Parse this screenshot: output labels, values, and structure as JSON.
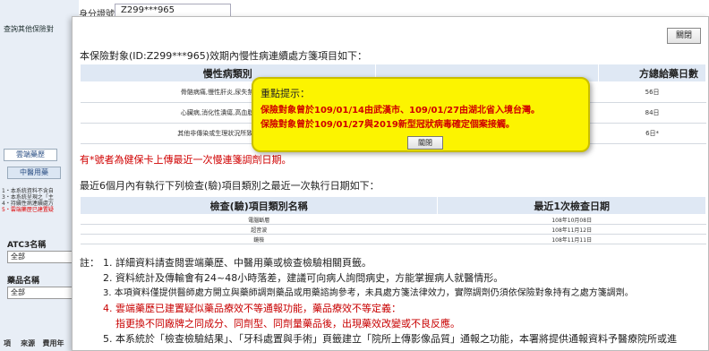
{
  "background": {
    "id_label": "身分證號：",
    "id_value": "Z299***965",
    "query_other": "查詢其他保險對",
    "tab_cloud": "雲端藥歷",
    "tab_chinese": "中醫用藥",
    "notes": [
      "1・本系統資料不含自",
      "3・本系統呈現之「主",
      "4・持續性病連續處方",
      "5・雲端藥歷已建置疑"
    ],
    "atc_label": "ATC3名稱",
    "atc_value": "全部",
    "drug_label": "藥品名稱",
    "drug_value": "全部",
    "footer_cols": [
      "項",
      "來源",
      "費用年"
    ]
  },
  "dialog": {
    "close_label": "關閉",
    "chronic_title": "本保險對象(ID:Z299***965)效期內慢性病連續處方箋項目如下：",
    "chronic_headers": [
      "慢性病類別",
      "方總給藥日數"
    ],
    "chronic_rows": [
      {
        "category": "骨骼病痛,慢性肝炎,尿失禁,身心疾",
        "days": "56日"
      },
      {
        "category": "心臟病,消化性潰瘍,高血脂症,高血",
        "days": "84日"
      },
      {
        "category": "其他非傳染或生理狀況所致之睡眠疾",
        "days": "6日*"
      }
    ],
    "star_note": "有*號者為健保卡上傳最近一次慢連箋調劑日期。",
    "exam_title": "最近6個月內有執行下列檢查(驗)項目類別之最近一次執行日期如下：",
    "exam_headers": [
      "檢查(驗)項目類別名稱",
      "最近1次檢查日期"
    ],
    "exam_rows": [
      {
        "name": "電腦斷層",
        "date": "108年10月08日"
      },
      {
        "name": "超音波",
        "date": "108年11月12日"
      },
      {
        "name": "鏡檢",
        "date": "108年11月11日"
      }
    ],
    "notes_lead": "註：",
    "notes": [
      "1. 詳細資料請查閱雲端藥歷、中醫用藥或檢查檢驗相關頁籤。",
      "2. 資料統計及傳輸會有24~48小時落差，建議可向病人詢問病史，方能掌握病人就醫情形。",
      "3. 本項資料僅提供醫師處方開立與藥師調劑藥品或用藥諮詢參考，未具處方箋法律效力，實際調劑仍須依保險對象持有之處方箋調劑。",
      "4. 雲端藥歷已建置疑似藥品療效不等通報功能，藥品療效不等定義：",
      "指更換不同廠牌之同成分、同劑型、同劑量藥品後，出現藥效改變或不良反應。",
      "5. 本系統於「檢查檢驗結果」、「牙科處置與手術」頁籤建立「院所上傳影像品質」通報之功能，本署將提供通報資料予醫療院所或進"
    ]
  },
  "alert": {
    "title": "重點提示：",
    "line1": "保險對象曾於109/01/14由武漢市、109/01/27由湖北省入境台灣。",
    "line2": "保險對象曾於109/01/27與2019新型冠狀病毒確定個案接觸。",
    "close_label": "關閉"
  },
  "colors": {
    "alert_bg": "#fcf400",
    "alert_text": "#d00000",
    "header_bg": "#dfe8f4"
  }
}
